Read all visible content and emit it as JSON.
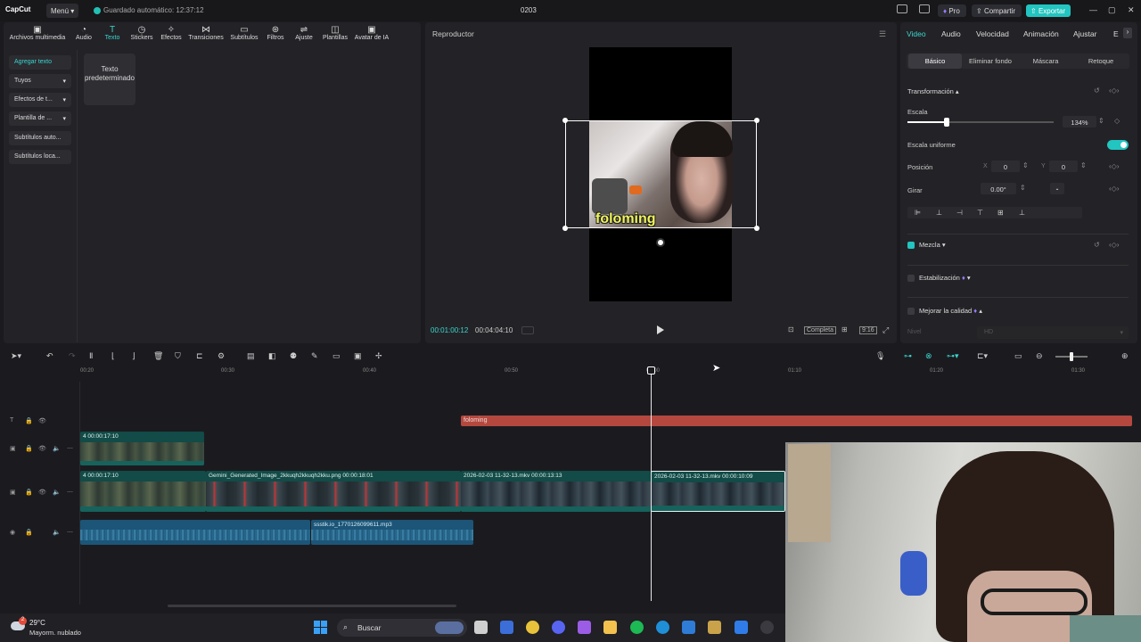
{
  "app": {
    "logo": "CapCut",
    "menu_label": "Menú ▾",
    "autosave": "Guardado automático: 12:37:12",
    "project_title": "0203",
    "pro_label": "Pro",
    "share_label": "Compartir",
    "export_label": "Exportar"
  },
  "toolbar_tabs": [
    {
      "label": "Archivos multimedia",
      "icon": "media-icon"
    },
    {
      "label": "Audio",
      "icon": "audio-icon"
    },
    {
      "label": "Texto",
      "icon": "text-icon"
    },
    {
      "label": "Stickers",
      "icon": "sticker-icon"
    },
    {
      "label": "Efectos",
      "icon": "effects-icon"
    },
    {
      "label": "Transiciones",
      "icon": "transitions-icon"
    },
    {
      "label": "Subtítulos",
      "icon": "subtitles-icon"
    },
    {
      "label": "Filtros",
      "icon": "filters-icon"
    },
    {
      "label": "Ajuste",
      "icon": "adjust-icon"
    },
    {
      "label": "Plantillas",
      "icon": "templates-icon"
    },
    {
      "label": "Avatar de IA",
      "icon": "ai-avatar-icon"
    }
  ],
  "side_menu": [
    {
      "label": "Agregar texto"
    },
    {
      "label": "Tuyos"
    },
    {
      "label": "Efectos de t..."
    },
    {
      "label": "Plantilla de ..."
    },
    {
      "label": "Subtítulos auto..."
    },
    {
      "label": "Subtítulos loca..."
    }
  ],
  "default_text_card": "Texto predeterminado",
  "player": {
    "title": "Reproductor",
    "caption": "foloming",
    "time_current": "00:01:00:12",
    "time_total": "00:04:04:10",
    "full_label": "Completa",
    "ratio_label": "9:16"
  },
  "right_panel": {
    "tabs": [
      "Video",
      "Audio",
      "Velocidad",
      "Animación",
      "Ajustar",
      "E"
    ],
    "subtabs": [
      "Básico",
      "Eliminar fondo",
      "Máscara",
      "Retoque"
    ],
    "transform_label": "Transformación",
    "scale_label": "Escala",
    "scale_value": "134%",
    "scale_level": 0.27,
    "uniform_scale_label": "Escala uniforme",
    "position_label": "Posición",
    "pos_x_label": "X",
    "pos_x": "0",
    "pos_y_label": "Y",
    "pos_y": "0",
    "rotate_label": "Girar",
    "rotate_value": "0.00°",
    "blend_label": "Mezcla",
    "stabilization_label": "Estabilización",
    "quality_label": "Mejorar la calidad",
    "level_label": "Nivel",
    "level_value": "HD"
  },
  "ruler": [
    "00:20",
    "00:30",
    "00:40",
    "00:50",
    "01:00",
    "01:10",
    "01:20",
    "01:30"
  ],
  "tracks": {
    "text_clip": "foloming",
    "overlay_clip": "4  00:00:17:10",
    "main_clips": [
      {
        "label": "4  00:00:17:10"
      },
      {
        "label": "Gemini_Generated_Image_2kkuqh2kkuqh2kku.png  00:00:18:01"
      },
      {
        "label": "2026-02-03 11-32-13.mkv  00:00:13:13"
      },
      {
        "label": "2026-02-03 11-32-13.mkv  00:00:10:09"
      }
    ],
    "audio_clip": "ssstik.io_1770126099611.mp3"
  },
  "taskbar": {
    "weather_temp": "29°C",
    "weather_desc": "Mayorm. nublado",
    "weather_badge": "2",
    "search_placeholder": "Buscar"
  },
  "colors": {
    "accent": "#22c5c0",
    "text_clip": "#b4483f",
    "video_clip": "#124b47",
    "audio_clip": "#1c5577"
  }
}
